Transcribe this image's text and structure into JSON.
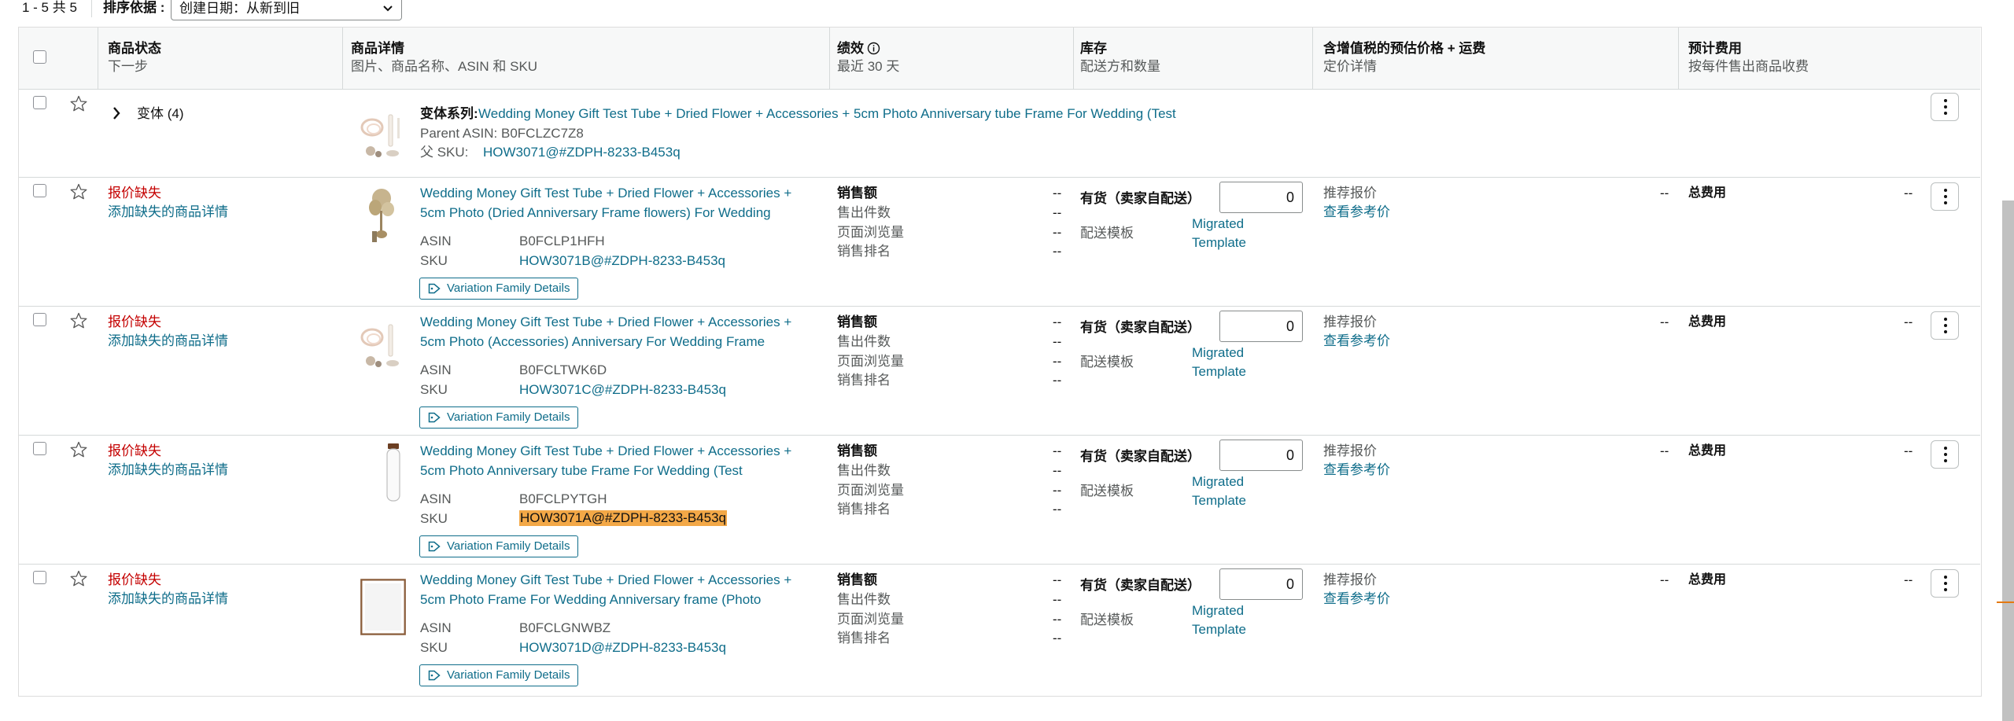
{
  "toolbar": {
    "result_count": "1 - 5 共 5",
    "sort_label": "排序依据 :",
    "sort_value": "创建日期：从新到旧"
  },
  "header": {
    "status": {
      "title": "商品状态",
      "sub": "下一步"
    },
    "details": {
      "title": "商品详情",
      "sub": "图片、商品名称、ASIN 和 SKU"
    },
    "performance": {
      "title": "绩效",
      "sub": "最近 30 天"
    },
    "inventory": {
      "title": "库存",
      "sub": "配送方和数量"
    },
    "price": {
      "title": "含增值税的预估价格 + 运费",
      "sub": "定价详情"
    },
    "fees": {
      "title": "预计费用",
      "sub": "按每件售出商品收费"
    }
  },
  "parent": {
    "variations_label": "变体 (4)",
    "series_label": "变体系列:",
    "series_title": "Wedding Money Gift Test Tube + Dried Flower + Accessories + 5cm Photo Anniversary tube Frame For Wedding (Test",
    "parent_asin": "Parent ASIN: B0FCLZC7Z8",
    "parent_sku_label": "父 SKU:",
    "parent_sku": "HOW3071@#ZDPH-8233-B453q"
  },
  "labels": {
    "missing_price": "报价缺失",
    "add_details": "添加缺失的商品详情",
    "asin": "ASIN",
    "sku": "SKU",
    "variation_btn": "Variation Family Details",
    "sales": "销售额",
    "units": "售出件数",
    "pageviews": "页面浏览量",
    "rank": "销售排名",
    "dash": "--",
    "instock": "有货（卖家自配送）",
    "ship_template": "配送模板",
    "migrated1": "Migrated",
    "migrated2": "Template",
    "suggested": "推荐报价",
    "reference": "查看参考价",
    "total_fee": "总费用"
  },
  "rows": [
    {
      "title1": "Wedding Money Gift Test Tube + Dried Flower + Accessories +",
      "title2": "5cm Photo (Dried Anniversary Frame flowers) For Wedding",
      "asin": "B0FCLP1HFH",
      "sku": "HOW3071B@#ZDPH-8233-B453q",
      "qty": "0"
    },
    {
      "title1": "Wedding Money Gift Test Tube + Dried Flower + Accessories +",
      "title2": "5cm Photo (Accessories) Anniversary For Wedding Frame",
      "asin": "B0FCLTWK6D",
      "sku": "HOW3071C@#ZDPH-8233-B453q",
      "qty": "0"
    },
    {
      "title1": "Wedding Money Gift Test Tube + Dried Flower + Accessories +",
      "title2": "5cm Photo Anniversary tube Frame For Wedding (Test",
      "asin": "B0FCLPYTGH",
      "sku": "HOW3071A@#ZDPH-8233-B453q",
      "qty": "0"
    },
    {
      "title1": "Wedding Money Gift Test Tube + Dried Flower + Accessories +",
      "title2": "5cm Photo Frame For Wedding Anniversary frame (Photo",
      "asin": "B0FCLGNWBZ",
      "sku": "HOW3071D@#ZDPH-8233-B453q",
      "qty": "0"
    }
  ],
  "colors": {
    "link": "#0F6D8A",
    "missing": "#C40000",
    "highlight": "#F3A847"
  }
}
